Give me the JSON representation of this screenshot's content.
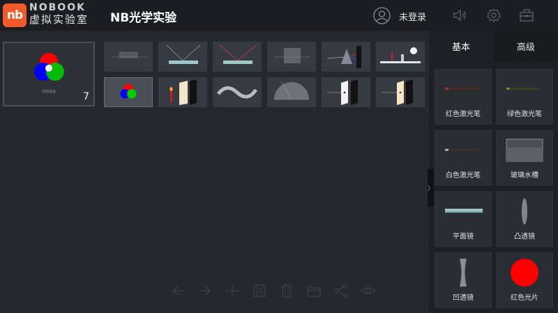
{
  "brand": {
    "logo_text": "nb",
    "name_en": "NOBOOK",
    "name_cn": "虚拟实验室"
  },
  "header": {
    "title": "NB光学实验",
    "login_label": "未登录"
  },
  "icons": {
    "user": "user-icon",
    "sound": "speaker-icon",
    "settings": "gear-icon",
    "toolbox": "toolbox-icon"
  },
  "main_thumbnail": {
    "count": "7",
    "caption": "光的混合"
  },
  "sidebar": {
    "tabs": [
      "基本",
      "高级"
    ],
    "items": [
      {
        "label": "红色激光笔"
      },
      {
        "label": "绿色激光笔"
      },
      {
        "label": "白色激光笔"
      },
      {
        "label": "玻璃水槽"
      },
      {
        "label": "平面镜"
      },
      {
        "label": "凸透镜"
      },
      {
        "label": "凹透镜"
      },
      {
        "label": "红色光片"
      }
    ]
  },
  "toolbar": [
    "undo-icon",
    "redo-icon",
    "add-icon",
    "save-icon",
    "delete-icon",
    "folder-icon",
    "share-icon",
    "eye-icon"
  ],
  "colors": {
    "accent": "#f05a28",
    "red": "#ff0000",
    "green": "#00cc00",
    "blue": "#0000ff"
  }
}
